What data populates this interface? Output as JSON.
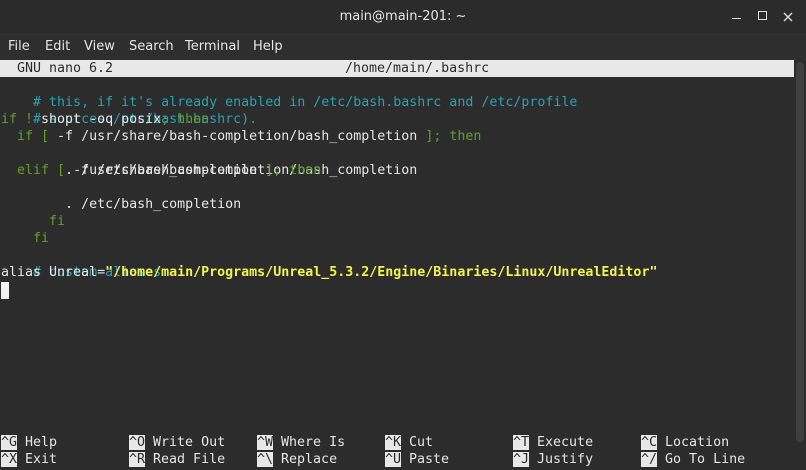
{
  "window": {
    "title": "main@main-201: ~"
  },
  "menu": {
    "items": [
      "File",
      "Edit",
      "View",
      "Search",
      "Terminal",
      "Help"
    ]
  },
  "nano": {
    "version": "GNU nano 6.2",
    "filename": "/home/main/.bashrc"
  },
  "editor": {
    "lines": [
      {
        "text": "# this, if it's already enabled in /etc/bash.bashrc and /etc/profile"
      },
      {
        "text": "# sources /etc/bash.bashrc)."
      },
      {
        "p1": "if ! ",
        "p2": "shopt -oq posix",
        "p3": "; then"
      },
      {
        "p1": "  if [ ",
        "p2": "-f",
        "p3": " /usr/share/bash-completion/bash_completion ",
        "p4": "]; then"
      },
      {
        "text": "    . /usr/share/bash-completion/bash_completion"
      },
      {
        "p1": "  elif [ ",
        "p2": "-f",
        "p3": " /etc/bash_completion ",
        "p4": "]; then"
      },
      {
        "text": "    . /etc/bash_completion"
      },
      {
        "text": "  fi"
      },
      {
        "text": "fi"
      },
      {
        "text": ""
      },
      {
        "text": "# custom aliases"
      },
      {
        "p1": "alias Unreal=",
        "p2": "\"/home/main/Programs/Unreal_5.3.2/Engine/Binaries/Linux/UnrealEditor\""
      }
    ]
  },
  "shortcuts": [
    {
      "key": "^G",
      "label": "Help"
    },
    {
      "key": "^O",
      "label": "Write Out"
    },
    {
      "key": "^W",
      "label": "Where Is"
    },
    {
      "key": "^K",
      "label": "Cut"
    },
    {
      "key": "^T",
      "label": "Execute"
    },
    {
      "key": "^C",
      "label": "Location"
    },
    {
      "key": "^X",
      "label": "Exit"
    },
    {
      "key": "^R",
      "label": "Read File"
    },
    {
      "key": "^\\",
      "label": "Replace"
    },
    {
      "key": "^U",
      "label": "Paste"
    },
    {
      "key": "^J",
      "label": "Justify"
    },
    {
      "key": "^/",
      "label": "Go To Line"
    }
  ],
  "colors": {
    "comment": "#2aa1b3",
    "keyword": "#5fa02d",
    "string": "#f4f44f",
    "background": "#2c2c2c"
  }
}
